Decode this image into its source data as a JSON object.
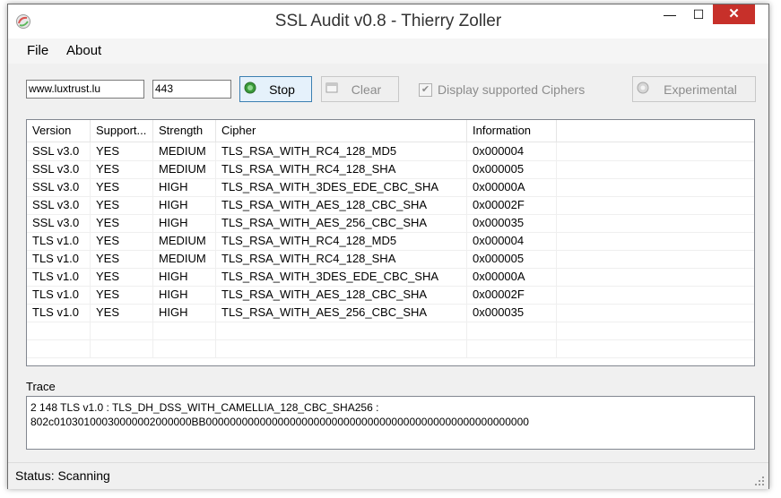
{
  "window": {
    "title": "SSL Audit v0.8  - Thierry Zoller",
    "minimize": "—",
    "maximize": "☐",
    "close": "✕"
  },
  "menu": [
    {
      "label": "File"
    },
    {
      "label": "About"
    }
  ],
  "toolbar": {
    "host_value": "www.luxtrust.lu",
    "port_value": "443",
    "stop_label": "Stop",
    "clear_label": "Clear",
    "display_ciphers_label": "Display supported Ciphers",
    "display_ciphers_checked": true,
    "experimental_label": "Experimental"
  },
  "table": {
    "columns": [
      "Version",
      "Support...",
      "Strength",
      "Cipher",
      "Information"
    ],
    "rows": [
      [
        "SSL v3.0",
        "YES",
        "MEDIUM",
        "TLS_RSA_WITH_RC4_128_MD5",
        "0x000004"
      ],
      [
        "SSL v3.0",
        "YES",
        "MEDIUM",
        "TLS_RSA_WITH_RC4_128_SHA",
        "0x000005"
      ],
      [
        "SSL v3.0",
        "YES",
        "HIGH",
        "TLS_RSA_WITH_3DES_EDE_CBC_SHA",
        "0x00000A"
      ],
      [
        "SSL v3.0",
        "YES",
        "HIGH",
        "TLS_RSA_WITH_AES_128_CBC_SHA",
        "0x00002F"
      ],
      [
        "SSL v3.0",
        "YES",
        "HIGH",
        "TLS_RSA_WITH_AES_256_CBC_SHA",
        "0x000035"
      ],
      [
        "TLS v1.0",
        "YES",
        "MEDIUM",
        "TLS_RSA_WITH_RC4_128_MD5",
        "0x000004"
      ],
      [
        "TLS v1.0",
        "YES",
        "MEDIUM",
        "TLS_RSA_WITH_RC4_128_SHA",
        "0x000005"
      ],
      [
        "TLS v1.0",
        "YES",
        "HIGH",
        "TLS_RSA_WITH_3DES_EDE_CBC_SHA",
        "0x00000A"
      ],
      [
        "TLS v1.0",
        "YES",
        "HIGH",
        "TLS_RSA_WITH_AES_128_CBC_SHA",
        "0x00002F"
      ],
      [
        "TLS v1.0",
        "YES",
        "HIGH",
        "TLS_RSA_WITH_AES_256_CBC_SHA",
        "0x000035"
      ]
    ]
  },
  "trace": {
    "label": "Trace",
    "text": "2 148 TLS v1.0 : TLS_DH_DSS_WITH_CAMELLIA_128_CBC_SHA256 :\n802c01030100030000002000000BB000000000000000000000000000000000000000000000000000000"
  },
  "status": {
    "text": "Status: Scanning"
  },
  "colors": {
    "close_button": "#c7302a",
    "stop_icon": "#3a9a3a"
  }
}
